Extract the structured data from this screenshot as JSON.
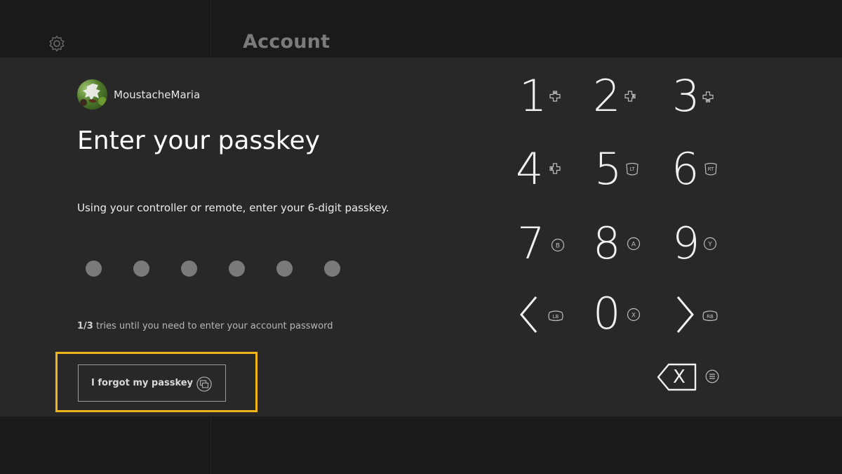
{
  "header": {
    "title": "Account",
    "settings_icon": "gear-icon"
  },
  "user": {
    "gamertag": "MoustacheMaria",
    "avatar_icon": "avatar"
  },
  "passkey_prompt": {
    "heading": "Enter your passkey",
    "instructions": "Using your controller or remote, enter your 6-digit passkey.",
    "digit_count": 6,
    "entered_count": 0,
    "tries_used": "1/3",
    "tries_text": " tries until you need to enter your account password"
  },
  "buttons": {
    "forgot_label": "I forgot my passkey",
    "forgot_hint_icon": "view-button-icon"
  },
  "keypad": {
    "keys": [
      {
        "label": "1",
        "hint": "dpad-up"
      },
      {
        "label": "2",
        "hint": "dpad-right"
      },
      {
        "label": "3",
        "hint": "dpad-down"
      },
      {
        "label": "4",
        "hint": "dpad-left"
      },
      {
        "label": "5",
        "hint": "LT"
      },
      {
        "label": "6",
        "hint": "RT"
      },
      {
        "label": "7",
        "hint": "B"
      },
      {
        "label": "8",
        "hint": "A"
      },
      {
        "label": "9",
        "hint": "Y"
      },
      {
        "label": "<",
        "hint": "LB"
      },
      {
        "label": "0",
        "hint": "X"
      },
      {
        "label": ">",
        "hint": "RB"
      }
    ],
    "backspace_label": "X",
    "backspace_hint_icon": "menu-button-icon"
  },
  "colors": {
    "focus": "#f1b41a",
    "panel": "#282828",
    "bars": "#1a1a1a"
  }
}
